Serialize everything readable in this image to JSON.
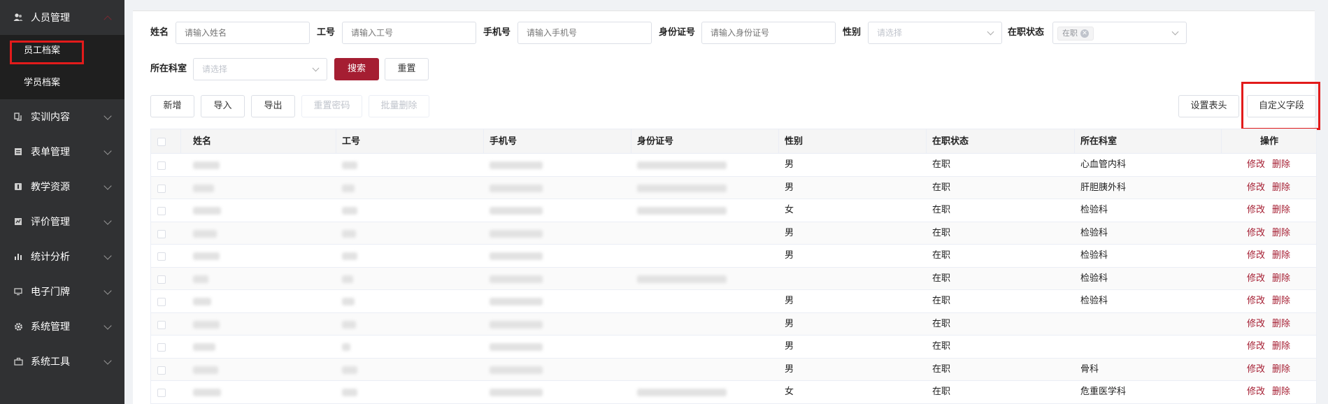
{
  "sidebar": {
    "groups": [
      {
        "label": "人员管理",
        "icon": "people-icon",
        "open": true
      },
      {
        "label": "实训内容",
        "icon": "training-icon"
      },
      {
        "label": "表单管理",
        "icon": "form-icon"
      },
      {
        "label": "教学资源",
        "icon": "resource-icon"
      },
      {
        "label": "评价管理",
        "icon": "evaluation-icon"
      },
      {
        "label": "统计分析",
        "icon": "bar-chart-icon"
      },
      {
        "label": "电子门牌",
        "icon": "monitor-icon"
      },
      {
        "label": "系统管理",
        "icon": "gear-icon"
      },
      {
        "label": "系统工具",
        "icon": "toolbox-icon"
      }
    ],
    "subitems": [
      {
        "label": "员工档案",
        "active": true
      },
      {
        "label": "学员档案"
      }
    ]
  },
  "filters": {
    "name": {
      "label": "姓名",
      "placeholder": "请输入姓名"
    },
    "job_no": {
      "label": "工号",
      "placeholder": "请输入工号"
    },
    "phone": {
      "label": "手机号",
      "placeholder": "请输入手机号"
    },
    "id_card": {
      "label": "身份证号",
      "placeholder": "请输入身份证号"
    },
    "gender": {
      "label": "性别",
      "placeholder": "请选择"
    },
    "status": {
      "label": "在职状态",
      "tag": "在职"
    },
    "dept": {
      "label": "所在科室",
      "placeholder": "请选择"
    },
    "search_btn": "搜索",
    "reset_btn": "重置"
  },
  "toolbar": {
    "add": "新增",
    "import": "导入",
    "export": "导出",
    "reset_password": "重置密码",
    "batch_delete": "批量删除",
    "set_header": "设置表头",
    "custom_field": "自定义字段"
  },
  "table": {
    "headers": [
      "姓名",
      "工号",
      "手机号",
      "身份证号",
      "性别",
      "在职状态",
      "所在科室",
      "操作"
    ],
    "edit_label": "修改",
    "delete_label": "删除",
    "rows": [
      {
        "gender": "男",
        "status": "在职",
        "dept": "心血管内科",
        "has_id": true
      },
      {
        "gender": "男",
        "status": "在职",
        "dept": "肝胆胰外科",
        "has_id": true
      },
      {
        "gender": "女",
        "status": "在职",
        "dept": "检验科",
        "has_id": true
      },
      {
        "gender": "男",
        "status": "在职",
        "dept": "检验科",
        "has_id": false
      },
      {
        "gender": "男",
        "status": "在职",
        "dept": "检验科",
        "has_id": false
      },
      {
        "gender": "",
        "status": "在职",
        "dept": "检验科",
        "has_id": true
      },
      {
        "gender": "男",
        "status": "在职",
        "dept": "检验科",
        "has_id": false
      },
      {
        "gender": "男",
        "status": "在职",
        "dept": "",
        "has_id": false
      },
      {
        "gender": "男",
        "status": "在职",
        "dept": "",
        "has_id": false
      },
      {
        "gender": "男",
        "status": "在职",
        "dept": "骨科",
        "has_id": false
      },
      {
        "gender": "女",
        "status": "在职",
        "dept": "危重医学科",
        "has_id": true
      }
    ]
  }
}
